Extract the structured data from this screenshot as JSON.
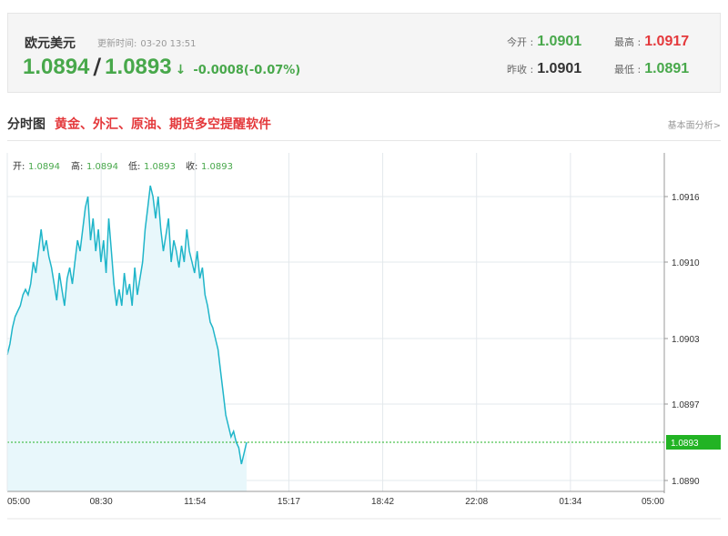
{
  "header": {
    "pair_name": "欧元美元",
    "update_label": "更新时间:",
    "update_time": "03-20 13:51",
    "bid": "1.0894",
    "ask": "1.0893",
    "direction_arrow": "↓",
    "change": "-0.0008(-0.07%)",
    "stats": {
      "open_label": "今开 :",
      "open_value": "1.0901",
      "high_label": "最高 :",
      "high_value": "1.0917",
      "prev_close_label": "昨收 :",
      "prev_close_value": "1.0901",
      "low_label": "最低 :",
      "low_value": "1.0891"
    }
  },
  "section": {
    "title": "分时图",
    "ad_text": "黄金、外汇、原油、期货多空提醒软件",
    "fundamental_link": "基本面分析>"
  },
  "ohlc": {
    "open_label": "开:",
    "open": "1.0894",
    "high_label": "高:",
    "high": "1.0894",
    "low_label": "低:",
    "low": "1.0893",
    "close_label": "收:",
    "close": "1.0893"
  },
  "colors": {
    "line": "#1fb5c9",
    "area_fill": "#e8f7fb",
    "up_green": "#48a84b",
    "accent_red": "#e4393c",
    "current_marker": "#22b324"
  },
  "chart_data": {
    "type": "area",
    "x_ticks": [
      "05:00",
      "08:30",
      "11:54",
      "15:17",
      "18:42",
      "22:08",
      "01:34",
      "05:00"
    ],
    "y_ticks": [
      "1.0916",
      "1.0910",
      "1.0903",
      "1.0897",
      "1.0890"
    ],
    "ylim": [
      1.0889,
      1.092
    ],
    "current_price": "1.0893",
    "current_price_value": 1.08935,
    "grid": true,
    "series": [
      {
        "values": [
          1.09015,
          1.09025,
          1.0904,
          1.0905,
          1.09055,
          1.0906,
          1.0907,
          1.09075,
          1.0907,
          1.0908,
          1.091,
          1.0909,
          1.0911,
          1.0913,
          1.0911,
          1.0912,
          1.09105,
          1.09095,
          1.0908,
          1.09065,
          1.0909,
          1.09075,
          1.0906,
          1.09085,
          1.09095,
          1.0908,
          1.091,
          1.0912,
          1.0911,
          1.0913,
          1.0915,
          1.0916,
          1.0912,
          1.0914,
          1.0911,
          1.0913,
          1.091,
          1.0912,
          1.0909,
          1.0914,
          1.0911,
          1.0908,
          1.0906,
          1.09075,
          1.0906,
          1.0909,
          1.0907,
          1.0908,
          1.0906,
          1.09095,
          1.0907,
          1.09085,
          1.091,
          1.0913,
          1.0915,
          1.0917,
          1.0916,
          1.0914,
          1.0916,
          1.0913,
          1.0911,
          1.09125,
          1.0914,
          1.091,
          1.0912,
          1.0911,
          1.09095,
          1.09115,
          1.091,
          1.0913,
          1.0911,
          1.091,
          1.0909,
          1.0911,
          1.09085,
          1.09095,
          1.0907,
          1.0906,
          1.09045,
          1.0904,
          1.0903,
          1.0902,
          1.09,
          1.0898,
          1.0896,
          1.0895,
          1.0894,
          1.08945,
          1.08935,
          1.0893,
          1.08915,
          1.08925,
          1.08935
        ]
      }
    ]
  }
}
